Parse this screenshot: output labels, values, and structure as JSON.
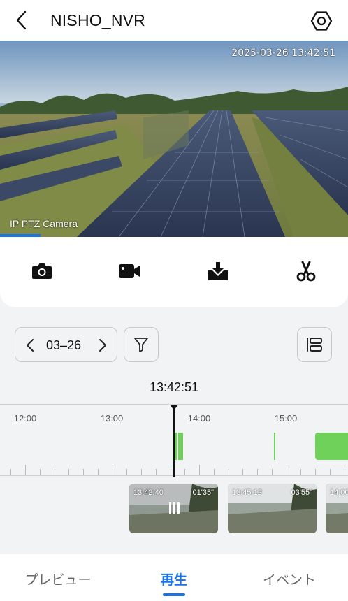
{
  "header": {
    "title": "NISHO_NVR"
  },
  "video": {
    "osd_timestamp": "2025-03-26 13:42:51",
    "camera_label": "IP PTZ Camera"
  },
  "toolbar": {
    "icons": [
      "camera-icon",
      "video-record-icon",
      "download-icon",
      "scissors-icon"
    ]
  },
  "date_selector": {
    "date": "03–26"
  },
  "timeline": {
    "current_time": "13:42:51",
    "hour_labels": [
      "12:00",
      "13:00",
      "14:00",
      "15:00"
    ]
  },
  "thumbnails": [
    {
      "time": "13:42:40",
      "duration": "01'35\""
    },
    {
      "time": "13:45:12",
      "duration": "03'55\""
    },
    {
      "time": "14:00",
      "duration": ""
    }
  ],
  "bottom_nav": {
    "items": [
      {
        "label": "プレビュー",
        "active": false
      },
      {
        "label": "再生",
        "active": true
      },
      {
        "label": "イベント",
        "active": false
      }
    ]
  },
  "colors": {
    "accent": "#1a73e8",
    "recording": "#6fd05a"
  }
}
